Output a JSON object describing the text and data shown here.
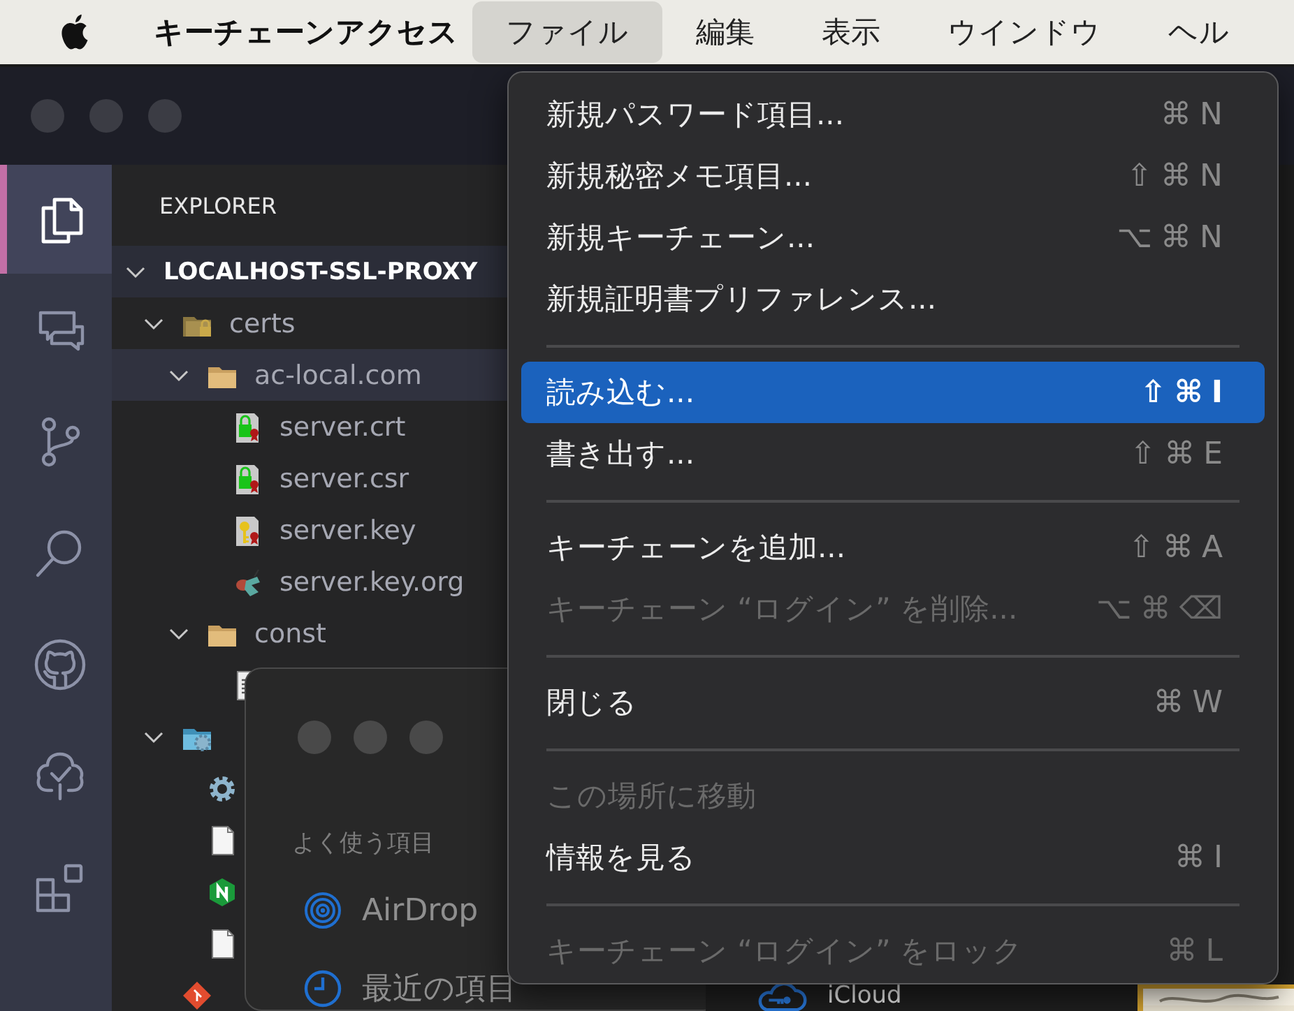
{
  "menu_bar": {
    "app_name": "キーチェーンアクセス",
    "menus": [
      {
        "label": "ファイル",
        "selected": true
      },
      {
        "label": "編集",
        "selected": false
      },
      {
        "label": "表示",
        "selected": false
      },
      {
        "label": "ウインドウ",
        "selected": false
      },
      {
        "label": "ヘル",
        "selected": false
      }
    ]
  },
  "editor_window": {
    "activity_bar": [
      {
        "kind": "files",
        "selected": true
      },
      {
        "kind": "chat",
        "selected": false
      },
      {
        "kind": "branch",
        "selected": false
      },
      {
        "kind": "search",
        "selected": false
      },
      {
        "kind": "github",
        "selected": false
      },
      {
        "kind": "tree",
        "selected": false
      },
      {
        "kind": "extensions",
        "selected": false
      }
    ],
    "explorer": {
      "title": "EXPLORER",
      "project": {
        "label": "LOCALHOST-SSL-PROXY",
        "expanded": true
      },
      "tree": [
        {
          "label": "certs",
          "kind": "folder-lock",
          "expanded": true,
          "selected": false,
          "children": [
            {
              "label": "ac-local.com",
              "kind": "folder",
              "expanded": true,
              "selected": true,
              "children": [
                {
                  "label": "server.crt",
                  "kind": "cert",
                  "selected": false
                },
                {
                  "label": "server.csr",
                  "kind": "cert",
                  "selected": false
                },
                {
                  "label": "server.key",
                  "kind": "key",
                  "selected": false
                },
                {
                  "label": "server.key.org",
                  "kind": "bird",
                  "selected": false
                }
              ]
            },
            {
              "label": "const",
              "kind": "folder",
              "expanded": true,
              "selected": false,
              "children": [
                {
                  "kind": "text",
                  "selected": false
                }
              ]
            }
          ]
        },
        {
          "kind": "folder-gear",
          "expanded": true,
          "selected": false,
          "children": [
            {
              "kind": "gear",
              "selected": false
            },
            {
              "kind": "file",
              "selected": false
            },
            {
              "kind": "nginx",
              "selected": false
            },
            {
              "kind": "file",
              "selected": false
            }
          ]
        },
        {
          "kind": "git",
          "selected": false
        }
      ]
    }
  },
  "finder_window": {
    "section": "よく使う項目",
    "items": [
      {
        "kind": "airdrop",
        "label": "AirDrop"
      },
      {
        "kind": "clock",
        "label": "最近の項目"
      }
    ]
  },
  "keychain_window": {
    "sidebar_item": {
      "label": "iCloud"
    }
  },
  "file_menu": {
    "items": [
      {
        "kind": "item",
        "label": "新規パスワード項目...",
        "shortcut": "⌘N",
        "disabled": false,
        "selected": false
      },
      {
        "kind": "item",
        "label": "新規秘密メモ項目...",
        "shortcut": "⇧⌘N",
        "disabled": false,
        "selected": false
      },
      {
        "kind": "item",
        "label": "新規キーチェーン...",
        "shortcut": "⌥⌘N",
        "disabled": false,
        "selected": false
      },
      {
        "kind": "item",
        "label": "新規証明書プリファレンス...",
        "disabled": false,
        "selected": false
      },
      {
        "kind": "separator"
      },
      {
        "kind": "item",
        "label": "読み込む...",
        "shortcut": "⇧⌘I",
        "disabled": false,
        "selected": true
      },
      {
        "kind": "item",
        "label": "書き出す...",
        "shortcut": "⇧⌘E",
        "disabled": false,
        "selected": false
      },
      {
        "kind": "separator"
      },
      {
        "kind": "item",
        "label": "キーチェーンを追加...",
        "shortcut": "⇧⌘A",
        "disabled": false,
        "selected": false
      },
      {
        "kind": "item",
        "label": "キーチェーン “ログイン” を削除...",
        "shortcut": "⌥⌘⌫",
        "disabled": true,
        "selected": false
      },
      {
        "kind": "separator"
      },
      {
        "kind": "item",
        "label": "閉じる",
        "shortcut": "⌘W",
        "disabled": false,
        "selected": false
      },
      {
        "kind": "separator"
      },
      {
        "kind": "item",
        "label": "この場所に移動",
        "disabled": true,
        "selected": false
      },
      {
        "kind": "item",
        "label": "情報を見る",
        "shortcut": "⌘I",
        "disabled": false,
        "selected": false
      },
      {
        "kind": "separator"
      },
      {
        "kind": "item",
        "label": "キーチェーン “ログイン” をロック",
        "shortcut": "⌘L",
        "disabled": true,
        "selected": false
      }
    ]
  }
}
